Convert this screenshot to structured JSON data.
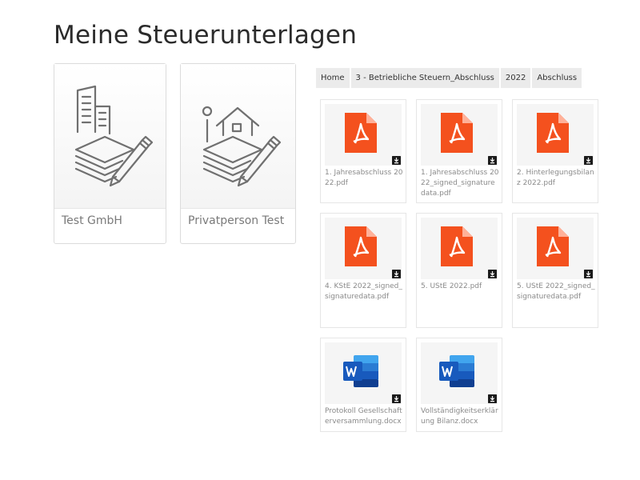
{
  "page": {
    "title": "Meine Steuerunterlagen"
  },
  "profiles": [
    {
      "label": "Test GmbH",
      "icon": "company-building-documents-icon"
    },
    {
      "label": "Privatperson Test",
      "icon": "private-house-documents-icon"
    }
  ],
  "breadcrumb": [
    "Home",
    "3 - Betriebliche Steuern_Abschluss",
    "2022",
    "Abschluss"
  ],
  "files": [
    {
      "name": "1. Jahresabschluss 2022.pdf",
      "type": "pdf"
    },
    {
      "name": "1. Jahresabschluss 2022_signed_signaturedata.pdf",
      "type": "pdf"
    },
    {
      "name": "2. Hinterlegungsbilanz 2022.pdf",
      "type": "pdf"
    },
    {
      "name": "4. KStE 2022_signed_signaturedata.pdf",
      "type": "pdf"
    },
    {
      "name": "5. UStE 2022.pdf",
      "type": "pdf"
    },
    {
      "name": "5. UStE 2022_signed_signaturedata.pdf",
      "type": "pdf"
    },
    {
      "name": "Protokoll Gesellschafterversammlung.docx",
      "type": "docx"
    },
    {
      "name": "Vollständigkeitserklärung Bilanz.docx",
      "type": "docx"
    }
  ],
  "colors": {
    "pdf": "#f4511e",
    "word_dark": "#185abd",
    "word_light": "#41a5ee",
    "download": "#1b1b1b"
  }
}
